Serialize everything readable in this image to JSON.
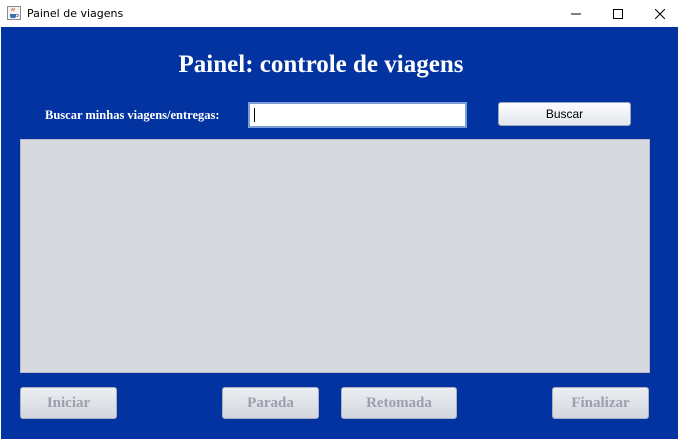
{
  "window": {
    "title": "Painel de viagens",
    "icon": "java-cup-icon",
    "controls": [
      "minimize-icon",
      "maximize-icon",
      "close-icon"
    ]
  },
  "header": {
    "title": "Painel: controle de viagens"
  },
  "search": {
    "label": "Buscar minhas viagens/entregas:",
    "value": "",
    "placeholder": "",
    "button_label": "Buscar"
  },
  "results": {
    "items": []
  },
  "actions": {
    "start_label": "Iniciar",
    "stop_label": "Parada",
    "resume_label": "Retomada",
    "finish_label": "Finalizar",
    "enabled": false
  },
  "colors": {
    "background": "#0233a0",
    "title_text": "#ffffff",
    "results_bg": "#d7d9df",
    "disabled_text": "#9aa0ad"
  }
}
